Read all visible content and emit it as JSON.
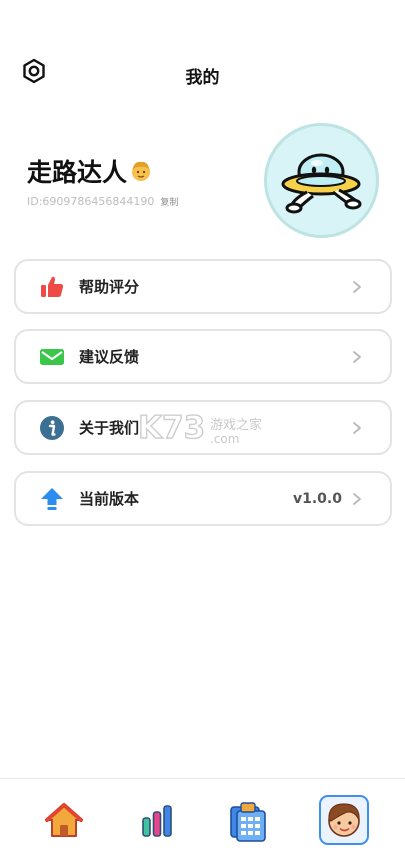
{
  "header": {
    "title": "我的",
    "settings_icon": "gear-icon"
  },
  "profile": {
    "nickname": "走路达人",
    "emoji": "man-emoji",
    "id_text": "ID:6909786456844190",
    "copy_label": "复制",
    "avatar": "ufo-mascot-avatar"
  },
  "menu": [
    {
      "label": "帮助评分",
      "icon": "thumbs-up-icon",
      "value": ""
    },
    {
      "label": "建议反馈",
      "icon": "mail-icon",
      "value": ""
    },
    {
      "label": "关于我们",
      "icon": "info-icon",
      "value": ""
    },
    {
      "label": "当前版本",
      "icon": "upgrade-arrow-icon",
      "value": "v1.0.0"
    }
  ],
  "watermark": {
    "brand": "K73",
    "sub": "游戏之家",
    "domain": ".com"
  },
  "tabbar": {
    "items": [
      {
        "icon": "home-icon"
      },
      {
        "icon": "bar-chart-icon"
      },
      {
        "icon": "calendar-icon"
      },
      {
        "icon": "profile-face-icon",
        "selected": true
      }
    ]
  },
  "colors": {
    "accent": "#3d8ff3",
    "thumb": "#ef4b46",
    "mail": "#3bc74a",
    "info": "#3b6f93",
    "arrow": "#2d8cf0"
  }
}
